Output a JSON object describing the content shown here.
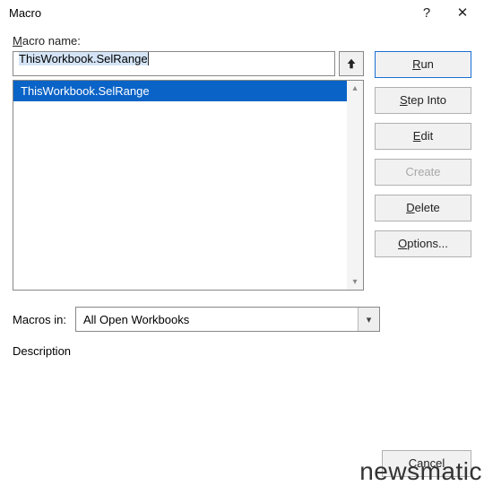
{
  "dialog": {
    "title": "Macro",
    "help": "?",
    "close": "✕"
  },
  "labels": {
    "macro_name": "Macro name:",
    "macros_in": "Macros in:",
    "description": "Description"
  },
  "macro_name_input": {
    "value": "ThisWorkbook.SelRange"
  },
  "macro_list": {
    "items": [
      "ThisWorkbook.SelRange"
    ]
  },
  "macros_in_select": {
    "value": "All Open Workbooks"
  },
  "buttons": {
    "run": "Run",
    "step_into": "Step Into",
    "edit": "Edit",
    "create": "Create",
    "delete": "Delete",
    "options": "Options...",
    "cancel": "Cancel"
  },
  "watermark": "newsmatic"
}
